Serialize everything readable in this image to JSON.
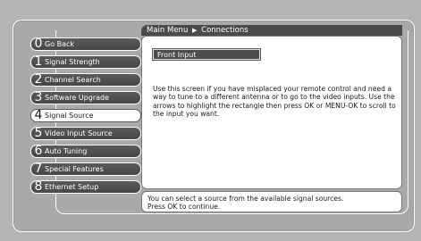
{
  "breadcrumb": {
    "root": "Main Menu",
    "separator": "▶",
    "current": "Connections"
  },
  "menu": {
    "items": [
      {
        "num": "0",
        "label": "Go Back",
        "active": false
      },
      {
        "num": "1",
        "label": "Signal Strength",
        "active": false
      },
      {
        "num": "2",
        "label": "Channel Search",
        "active": false
      },
      {
        "num": "3",
        "label": "Software Upgrade",
        "active": false
      },
      {
        "num": "4",
        "label": "Signal Source",
        "active": true
      },
      {
        "num": "5",
        "label": "Video Input Source",
        "active": false
      },
      {
        "num": "6",
        "label": "Auto Tuning",
        "active": false
      },
      {
        "num": "7",
        "label": "Special Features",
        "active": false
      },
      {
        "num": "8",
        "label": "Ethernet Setup",
        "active": false
      }
    ]
  },
  "content": {
    "selected_input": "Front Input",
    "help_text": "Use this screen if you have misplaced your remote control and need a way to tune to a different antenna or to go to the video inputs. Use the arrows to highlight the rectangle then press OK or MENU-OK to scroll to the input you want."
  },
  "status": {
    "line1": "You can select a source from the available signal sources.",
    "line2": "Press OK to continue."
  }
}
